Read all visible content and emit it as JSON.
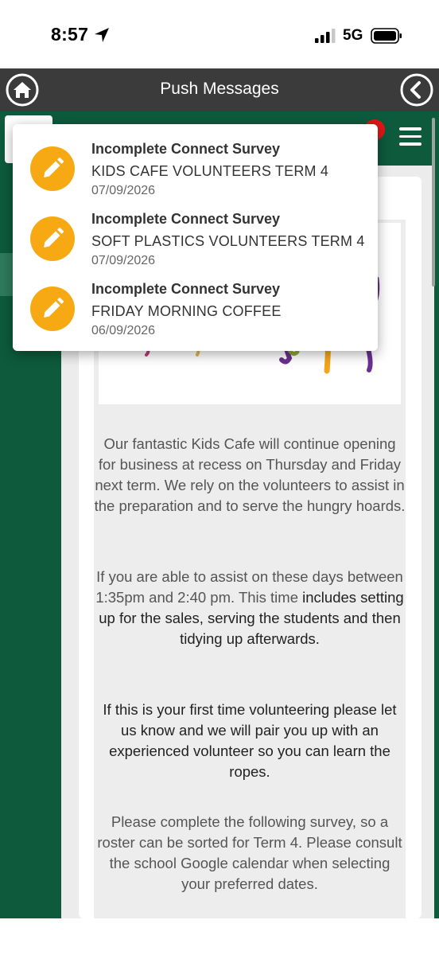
{
  "status_bar": {
    "time": "8:57",
    "network": "5G",
    "icons": [
      "location-arrow-icon",
      "signal-icon",
      "battery-icon"
    ]
  },
  "title_bar": {
    "title": "Push Messages",
    "home_icon": "home-icon",
    "back_icon": "back-arrow-icon"
  },
  "app_header": {
    "menu_icon": "hamburger-icon",
    "notification_badge_color": "#e01616"
  },
  "colors": {
    "brand_green": "#0d5a3c",
    "title_bar": "#3b3b3b",
    "message_icon": "#f7a913"
  },
  "messages": [
    {
      "title": "Incomplete Connect Survey",
      "subtitle": "KIDS CAFE VOLUNTEERS TERM 4",
      "date": "07/09/2026",
      "icon": "pencil-icon"
    },
    {
      "title": "Incomplete Connect Survey",
      "subtitle": "SOFT PLASTICS VOLUNTEERS TERM 4",
      "date": "07/09/2026",
      "icon": "pencil-icon"
    },
    {
      "title": "Incomplete Connect Survey",
      "subtitle": "FRIDAY MORNING COFFEE",
      "date": "06/09/2026",
      "icon": "pencil-icon"
    }
  ],
  "article": {
    "p1": "Our fantastic Kids Cafe will continue opening for business at recess on Thursday and Friday next term.  We rely on the volunteers to assist in the preparation and to serve the hungry hoards.",
    "p2_a": "If you are able to assist on these days between 1:35pm and 2:40 pm.  This time ",
    "p2_b": "includes setting up for the sales, serving the students and then tidying up afterwards.",
    "p3": "If this is your first time volunteering please let us know and we will pair you up with an experienced volunteer so you can learn the ropes.",
    "p4": "Please complete the following survey, so a roster can be sorted for Term 4.  Please consult the school Google calendar when selecting your preferred dates."
  }
}
